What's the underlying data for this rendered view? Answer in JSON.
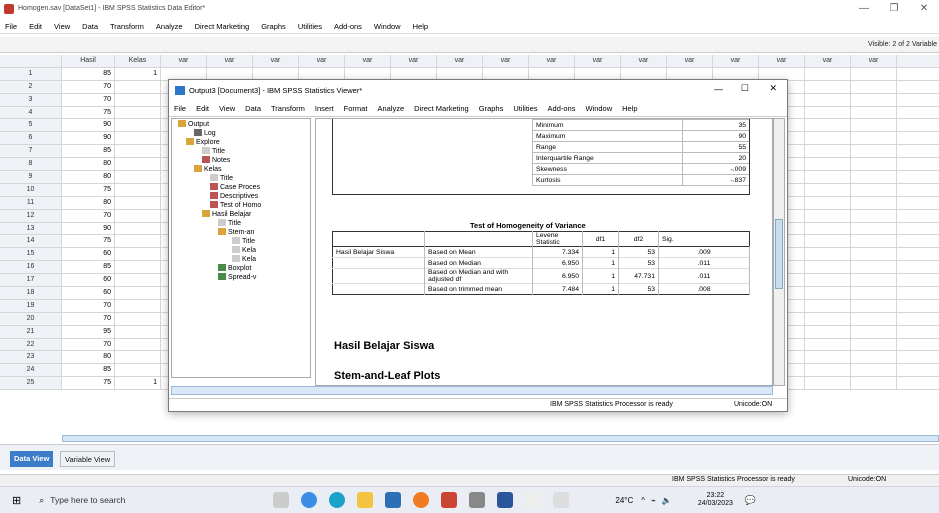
{
  "app": {
    "title": "Homogen.sav [DataSet1] - IBM SPSS Statistics Data Editor*"
  },
  "menu": [
    "File",
    "Edit",
    "View",
    "Data",
    "Transform",
    "Analyze",
    "Direct Marketing",
    "Graphs",
    "Utilities",
    "Add-ons",
    "Window",
    "Help"
  ],
  "visible_label": "Visible: 2 of 2 Variable",
  "grid": {
    "columns": [
      "Hasil",
      "Kelas",
      "var",
      "var",
      "var",
      "var",
      "var",
      "var",
      "var",
      "var",
      "var",
      "var",
      "var",
      "var",
      "var",
      "var",
      "var",
      "var"
    ],
    "rows": [
      {
        "n": "1",
        "hasil": "85",
        "kelas": "1"
      },
      {
        "n": "2",
        "hasil": "70",
        "kelas": ""
      },
      {
        "n": "3",
        "hasil": "70",
        "kelas": ""
      },
      {
        "n": "4",
        "hasil": "75",
        "kelas": ""
      },
      {
        "n": "5",
        "hasil": "90",
        "kelas": ""
      },
      {
        "n": "6",
        "hasil": "90",
        "kelas": ""
      },
      {
        "n": "7",
        "hasil": "85",
        "kelas": ""
      },
      {
        "n": "8",
        "hasil": "80",
        "kelas": ""
      },
      {
        "n": "9",
        "hasil": "80",
        "kelas": ""
      },
      {
        "n": "10",
        "hasil": "75",
        "kelas": ""
      },
      {
        "n": "11",
        "hasil": "80",
        "kelas": ""
      },
      {
        "n": "12",
        "hasil": "70",
        "kelas": ""
      },
      {
        "n": "13",
        "hasil": "90",
        "kelas": ""
      },
      {
        "n": "14",
        "hasil": "75",
        "kelas": ""
      },
      {
        "n": "15",
        "hasil": "60",
        "kelas": ""
      },
      {
        "n": "16",
        "hasil": "85",
        "kelas": ""
      },
      {
        "n": "17",
        "hasil": "60",
        "kelas": ""
      },
      {
        "n": "18",
        "hasil": "60",
        "kelas": ""
      },
      {
        "n": "19",
        "hasil": "70",
        "kelas": ""
      },
      {
        "n": "20",
        "hasil": "70",
        "kelas": ""
      },
      {
        "n": "21",
        "hasil": "95",
        "kelas": ""
      },
      {
        "n": "22",
        "hasil": "70",
        "kelas": ""
      },
      {
        "n": "23",
        "hasil": "80",
        "kelas": ""
      },
      {
        "n": "24",
        "hasil": "85",
        "kelas": ""
      },
      {
        "n": "25",
        "hasil": "75",
        "kelas": "1"
      }
    ]
  },
  "tabs": {
    "data_view": "Data View",
    "variable_view": "Variable View"
  },
  "statusbar": {
    "processor": "IBM SPSS Statistics Processor is ready",
    "unicode": "Unicode:ON"
  },
  "viewer": {
    "title": "Output3 [Document3] - IBM SPSS Statistics Viewer*",
    "menu": [
      "File",
      "Edit",
      "View",
      "Data",
      "Transform",
      "Insert",
      "Format",
      "Analyze",
      "Direct Marketing",
      "Graphs",
      "Utilities",
      "Add-ons",
      "Window",
      "Help"
    ],
    "tree": [
      "Output",
      "Log",
      "Explore",
      "Title",
      "Notes",
      "Kelas",
      "Title",
      "Case Proces",
      "Descriptives",
      "Test of Homo",
      "Hasil Belajar",
      "Title",
      "Stem-an",
      "Title",
      "Kela",
      "Kela",
      "Boxplot",
      "Spread-v"
    ],
    "stats": [
      {
        "label": "Minimum",
        "value": "35"
      },
      {
        "label": "Maximum",
        "value": "90"
      },
      {
        "label": "Range",
        "value": "55"
      },
      {
        "label": "Interquartile Range",
        "value": "20"
      },
      {
        "label": "Skewness",
        "value": "-.009"
      },
      {
        "label": "Kurtosis",
        "value": "-.837"
      }
    ],
    "homogeneity": {
      "title": "Test of Homogeneity of Variance",
      "headers": [
        "Levene Statistic",
        "df1",
        "df2",
        "Sig."
      ],
      "group": "Hasil Belajar Siswa",
      "rows": [
        {
          "label": "Based on Mean",
          "levene": "7.334",
          "df1": "1",
          "df2": "53",
          "sig": ".009"
        },
        {
          "label": "Based on Median",
          "levene": "6.950",
          "df1": "1",
          "df2": "53",
          "sig": ".011"
        },
        {
          "label": "Based on Median and with adjusted df",
          "levene": "6.950",
          "df1": "1",
          "df2": "47.731",
          "sig": ".011"
        },
        {
          "label": "Based on trimmed mean",
          "levene": "7.484",
          "df1": "1",
          "df2": "53",
          "sig": ".008"
        }
      ]
    },
    "heading1": "Hasil Belajar Siswa",
    "heading2": "Stem-and-Leaf Plots",
    "status": "IBM SPSS Statistics Processor is ready",
    "unicode": "Unicode:ON"
  },
  "taskbar": {
    "search_placeholder": "Type here to search",
    "weather": "24°C",
    "time": "23:22",
    "date": "24/03/2023"
  }
}
